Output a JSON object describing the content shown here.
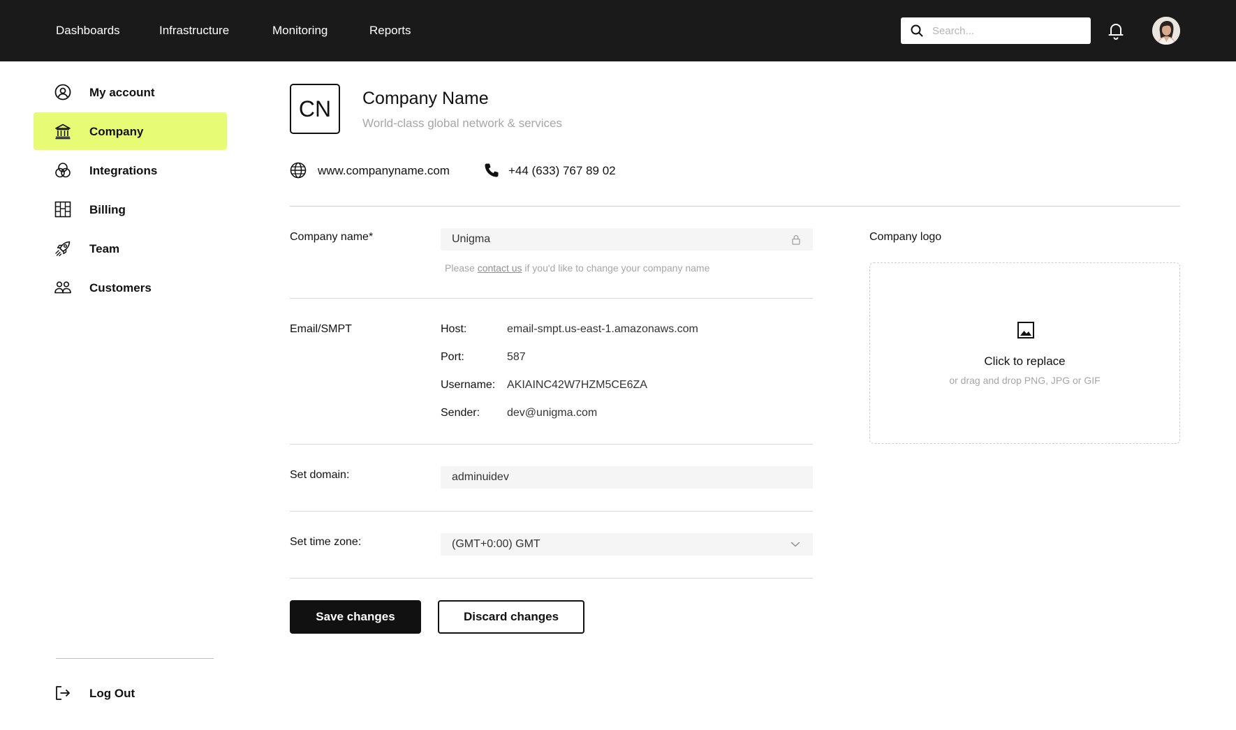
{
  "topnav": {
    "links": [
      "Dashboards",
      "Infrastructure",
      "Monitoring",
      "Reports"
    ],
    "search_placeholder": "Search...",
    "bell_icon": "bell-icon",
    "avatar_icon": "user-avatar"
  },
  "sidebar": {
    "items": [
      {
        "label": "My account",
        "icon": "user-circle-icon"
      },
      {
        "label": "Company",
        "icon": "bank-building-icon",
        "active": true
      },
      {
        "label": "Integrations",
        "icon": "overlapping-circles-icon"
      },
      {
        "label": "Billing",
        "icon": "billing-grid-icon"
      },
      {
        "label": "Team",
        "icon": "rocket-icon"
      },
      {
        "label": "Customers",
        "icon": "users-group-icon"
      }
    ],
    "logout_label": "Log Out",
    "logout_icon": "logout-arrow-icon",
    "active_color": "#e8fb74"
  },
  "company": {
    "initials": "CN",
    "title": "Company Name",
    "tagline": "World-class global network & services",
    "website": "www.companyname.com",
    "phone": "+44 (633) 767 89 02"
  },
  "form": {
    "company_name": {
      "label": "Company name*",
      "value": "Unigma",
      "hint_pre": "Please",
      "hint_link": "contact us",
      "hint_post": "if you'd like to change  your company name"
    },
    "smtp": {
      "label": "Email/SMPT",
      "host_key": "Host:",
      "host": "email-smpt.us-east-1.amazonaws.com",
      "port_key": "Port:",
      "port": "587",
      "username_key": "Username:",
      "username": "AKIAINC42W7HZM5CE6ZA",
      "sender_key": "Sender:",
      "sender": "dev@unigma.com"
    },
    "domain": {
      "label": "Set domain:",
      "value": "adminuidev"
    },
    "timezone": {
      "label": "Set time zone:",
      "value": "(GMT+0:00) GMT"
    },
    "save_label": "Save changes",
    "discard_label": "Discard changes"
  },
  "logo": {
    "label": "Company logo",
    "title": "Click to replace",
    "subtitle": "or drag and drop PNG, JPG or GIF"
  },
  "colors": {
    "topbar": "#1a1a1a",
    "accent": "#e8fb74",
    "primary_button": "#111111"
  }
}
